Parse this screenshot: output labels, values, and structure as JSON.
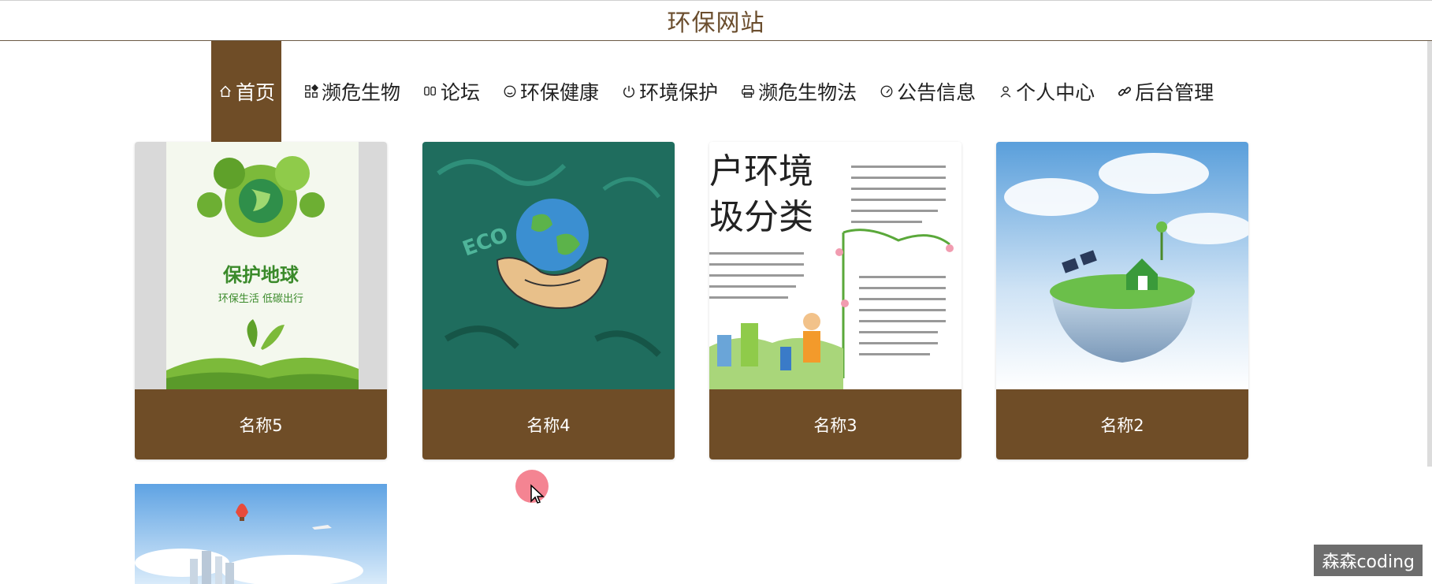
{
  "site": {
    "title": "环保网站"
  },
  "nav": {
    "items": [
      {
        "label": "首页",
        "icon": "home-icon",
        "active": true
      },
      {
        "label": "濒危生物",
        "icon": "grid-icon",
        "active": false
      },
      {
        "label": "论坛",
        "icon": "chat-icon",
        "active": false
      },
      {
        "label": "环保健康",
        "icon": "smile-icon",
        "active": false
      },
      {
        "label": "环境保护",
        "icon": "power-icon",
        "active": false
      },
      {
        "label": "濒危生物法",
        "icon": "printer-icon",
        "active": false
      },
      {
        "label": "公告信息",
        "icon": "gauge-icon",
        "active": false
      },
      {
        "label": "个人中心",
        "icon": "user-icon",
        "active": false
      },
      {
        "label": "后台管理",
        "icon": "link-icon",
        "active": false
      }
    ]
  },
  "cards": [
    {
      "label": "名称5",
      "poster_title": "保护地球",
      "poster_subtitle": "环保生活 低碳出行"
    },
    {
      "label": "名称4",
      "poster_text": "ECO"
    },
    {
      "label": "名称3",
      "poster_title_line1": "户环境",
      "poster_title_line2": "圾分类"
    },
    {
      "label": "名称2"
    }
  ],
  "watermark": {
    "text": "森森coding"
  },
  "colors": {
    "accent": "#6f4d27",
    "title": "#6b4e2e"
  }
}
